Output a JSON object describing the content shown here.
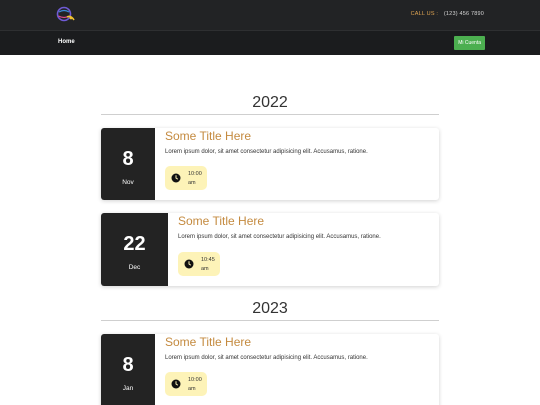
{
  "header": {
    "call_label": "CALL US :",
    "phone": "(123) 456 7890"
  },
  "nav": {
    "home_label": "Home",
    "account_label": "Mi Cuenta"
  },
  "groups": [
    {
      "year": "2022",
      "events": [
        {
          "day": "8",
          "month": "Nov",
          "title": "Some Title Here",
          "description": "Lorem ipsum dolor, sit amet consectetur adipisicing elit. Accusamus, ratione.",
          "time_line1": "10:00",
          "time_line2": "am"
        },
        {
          "day": "22",
          "month": "Dec",
          "title": "Some Title Here",
          "description": "Lorem ipsum dolor, sit amet consectetur adipisicing elit. Accusamus, ratione.",
          "time_line1": "10:45",
          "time_line2": "am"
        }
      ]
    },
    {
      "year": "2023",
      "events": [
        {
          "day": "8",
          "month": "Jan",
          "title": "Some Title Here",
          "description": "Lorem ipsum dolor, sit amet consectetur adipisicing elit. Accusamus, ratione.",
          "time_line1": "10:00",
          "time_line2": "am"
        }
      ]
    }
  ],
  "icons": {
    "logo": "globe-logo-icon",
    "clock": "clock-icon"
  }
}
